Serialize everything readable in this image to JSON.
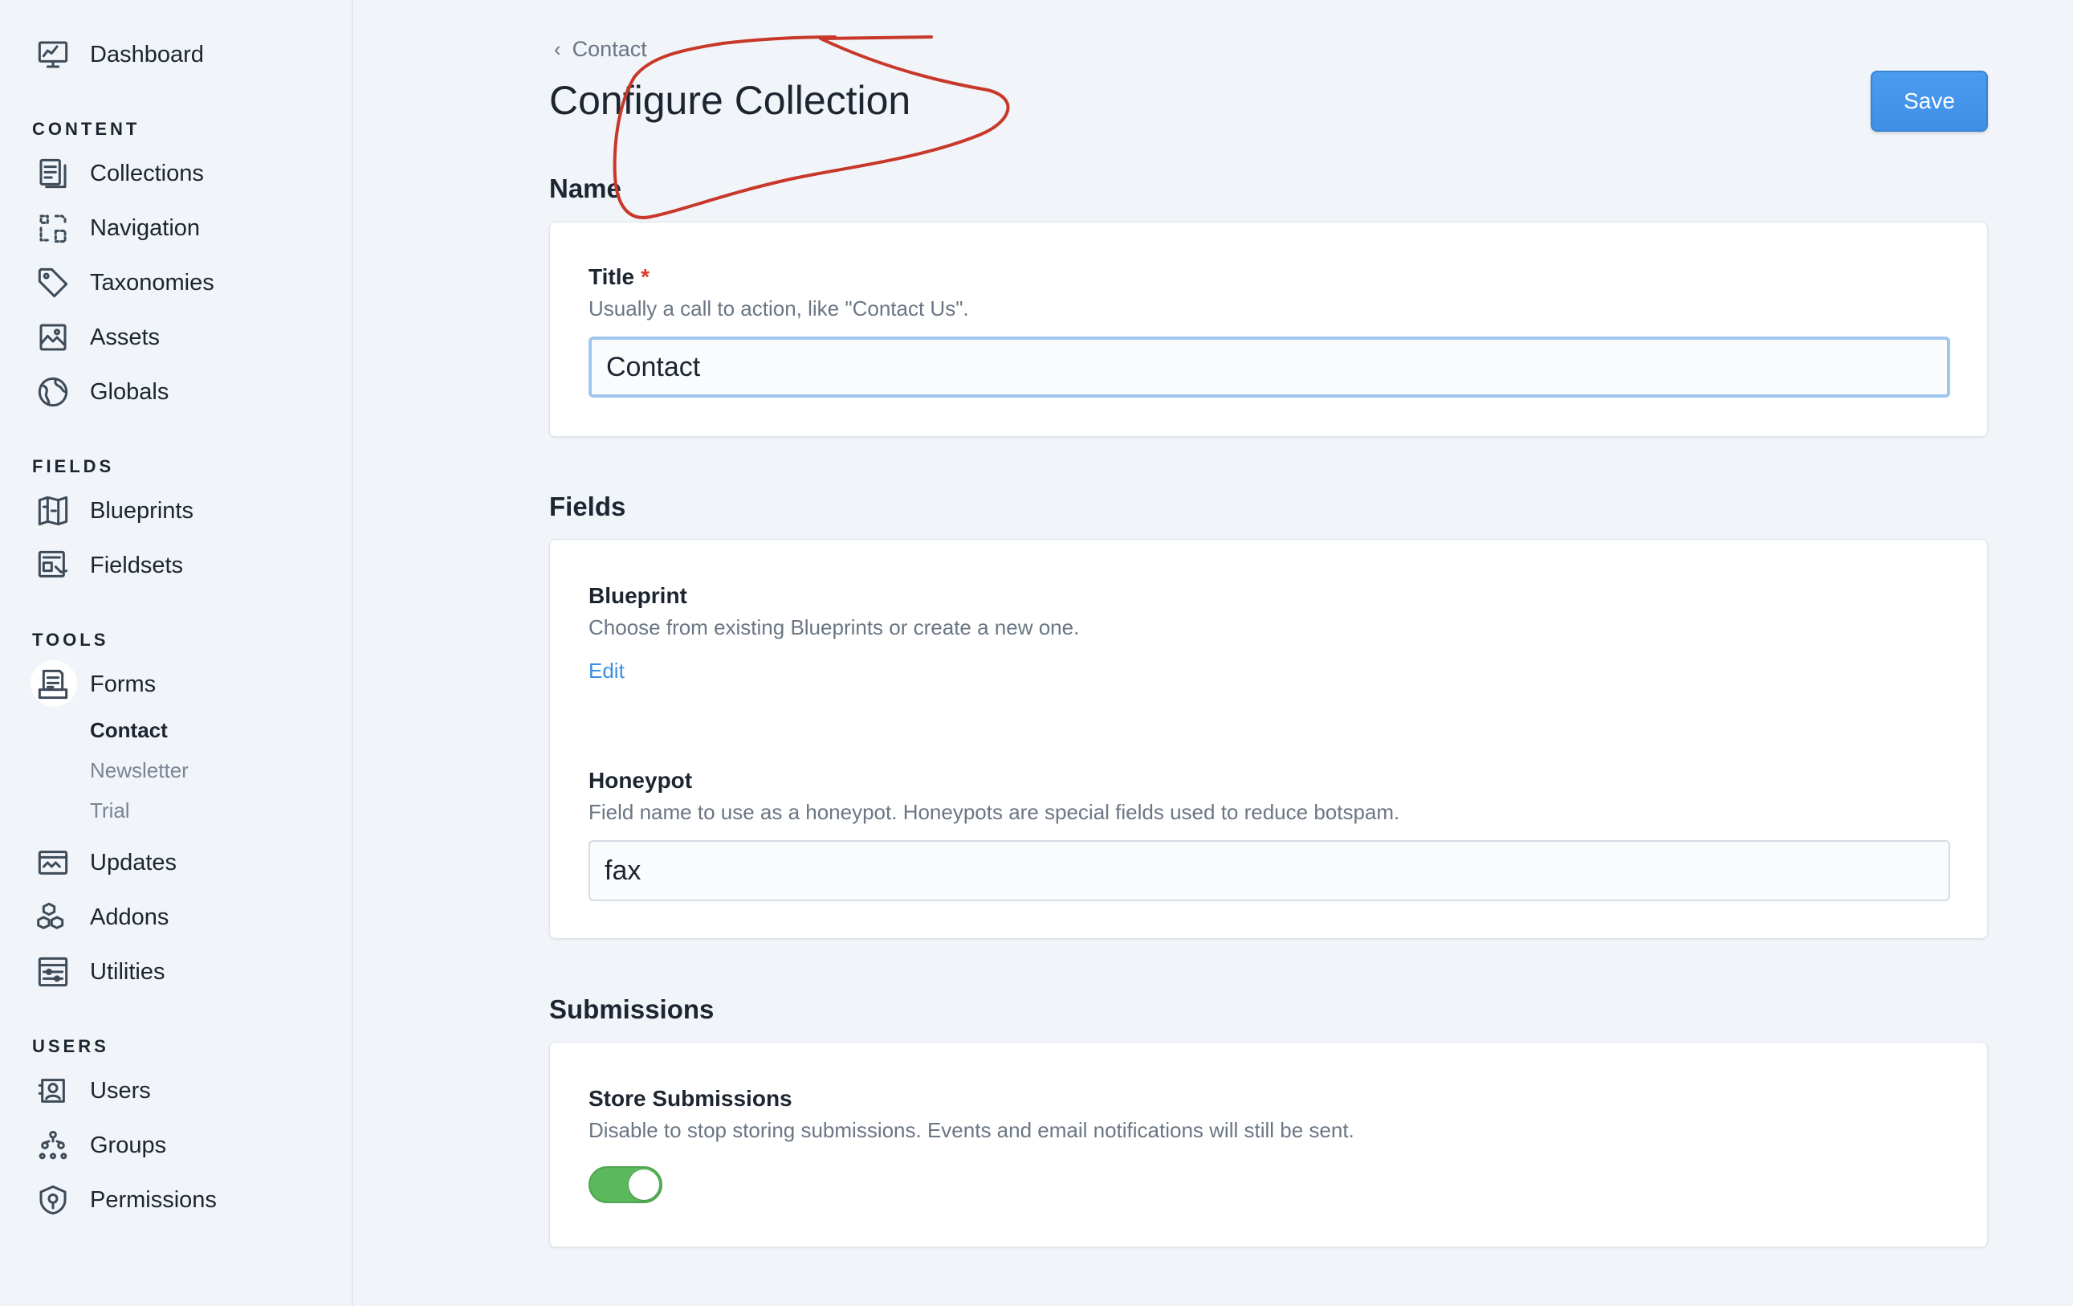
{
  "sidebar": {
    "dashboard": "Dashboard",
    "sections": {
      "content": "CONTENT",
      "fields": "FIELDS",
      "tools": "TOOLS",
      "users": "USERS"
    },
    "content_items": [
      "Collections",
      "Navigation",
      "Taxonomies",
      "Assets",
      "Globals"
    ],
    "fields_items": [
      "Blueprints",
      "Fieldsets"
    ],
    "tools_items": {
      "forms": "Forms",
      "forms_children": [
        "Contact",
        "Newsletter",
        "Trial"
      ],
      "active_child": "Contact",
      "updates": "Updates",
      "addons": "Addons",
      "utilities": "Utilities"
    },
    "users_items": [
      "Users",
      "Groups",
      "Permissions"
    ]
  },
  "header": {
    "breadcrumb": "Contact",
    "title": "Configure Collection",
    "save_label": "Save"
  },
  "sections": {
    "name": {
      "heading": "Name",
      "title_label": "Title",
      "required_mark": "*",
      "title_help": "Usually a call to action, like \"Contact Us\".",
      "title_value": "Contact"
    },
    "fields": {
      "heading": "Fields",
      "blueprint_label": "Blueprint",
      "blueprint_help": "Choose from existing Blueprints or create a new one.",
      "blueprint_edit": "Edit",
      "honeypot_label": "Honeypot",
      "honeypot_help": "Field name to use as a honeypot. Honeypots are special fields used to reduce botspam.",
      "honeypot_value": "fax"
    },
    "submissions": {
      "heading": "Submissions",
      "store_label": "Store Submissions",
      "store_help": "Disable to stop storing submissions. Events and email notifications will still be sent.",
      "store_enabled": true
    }
  },
  "colors": {
    "accent": "#3f8fe6",
    "toggle_on": "#5cb85c",
    "required": "#dc3c2c",
    "annotation": "#c8382a"
  }
}
